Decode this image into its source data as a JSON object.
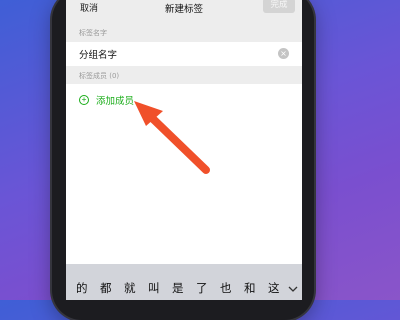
{
  "navbar": {
    "cancel_label": "取消",
    "title": "新建标签",
    "done_label": "完成"
  },
  "tag_name_section": {
    "label": "标签名字",
    "value": "分组名字"
  },
  "members_section": {
    "label": "标签成员 (0)",
    "add_member_label": "添加成员"
  },
  "keyboard": {
    "candidates": [
      "的",
      "都",
      "就",
      "叫",
      "是",
      "了",
      "也",
      "和",
      "这"
    ]
  },
  "colors": {
    "accent_green": "#1aad19",
    "annotation_arrow": "#f0502a",
    "background_gradient_start": "#3f5fd6",
    "background_gradient_end": "#8a55c9"
  },
  "icons": {
    "clear": "clear-icon",
    "add": "plus-circle-icon",
    "collapse": "chevron-down-icon"
  }
}
